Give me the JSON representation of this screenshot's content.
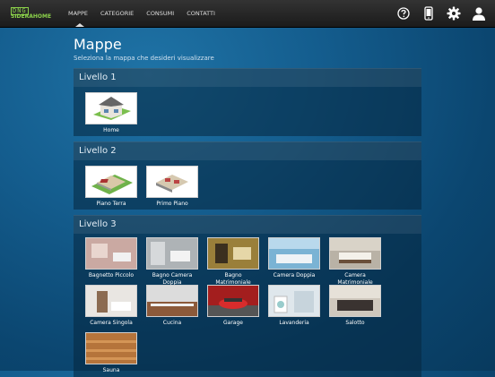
{
  "logo": {
    "line1": "DNG",
    "line2": "SIDERAHOME"
  },
  "nav": [
    "MAPPE",
    "CATEGORIE",
    "CONSUMI",
    "CONTATTI"
  ],
  "page": {
    "title": "Mappe",
    "subtitle": "Seleziona la mappa che desideri visualizzare"
  },
  "sections": [
    {
      "title": "Livello 1",
      "items": [
        "Home"
      ]
    },
    {
      "title": "Livello 2",
      "items": [
        "Piano Terra",
        "Primo Piano"
      ]
    },
    {
      "title": "Livello 3",
      "items": [
        "Bagnetto Piccolo",
        "Bagno Camera Doppia",
        "Bagno Matrimoniale",
        "Camera Doppia",
        "Camera Matrimoniale",
        "Camera Singola",
        "Cucina",
        "Garage",
        "Lavanderia",
        "Salotto",
        "Sauna"
      ]
    }
  ],
  "icons": [
    "help-icon",
    "phone-icon",
    "gear-icon",
    "user-icon"
  ],
  "colors": {
    "accent_green": "#8bd14a",
    "background": "#145d8e"
  }
}
